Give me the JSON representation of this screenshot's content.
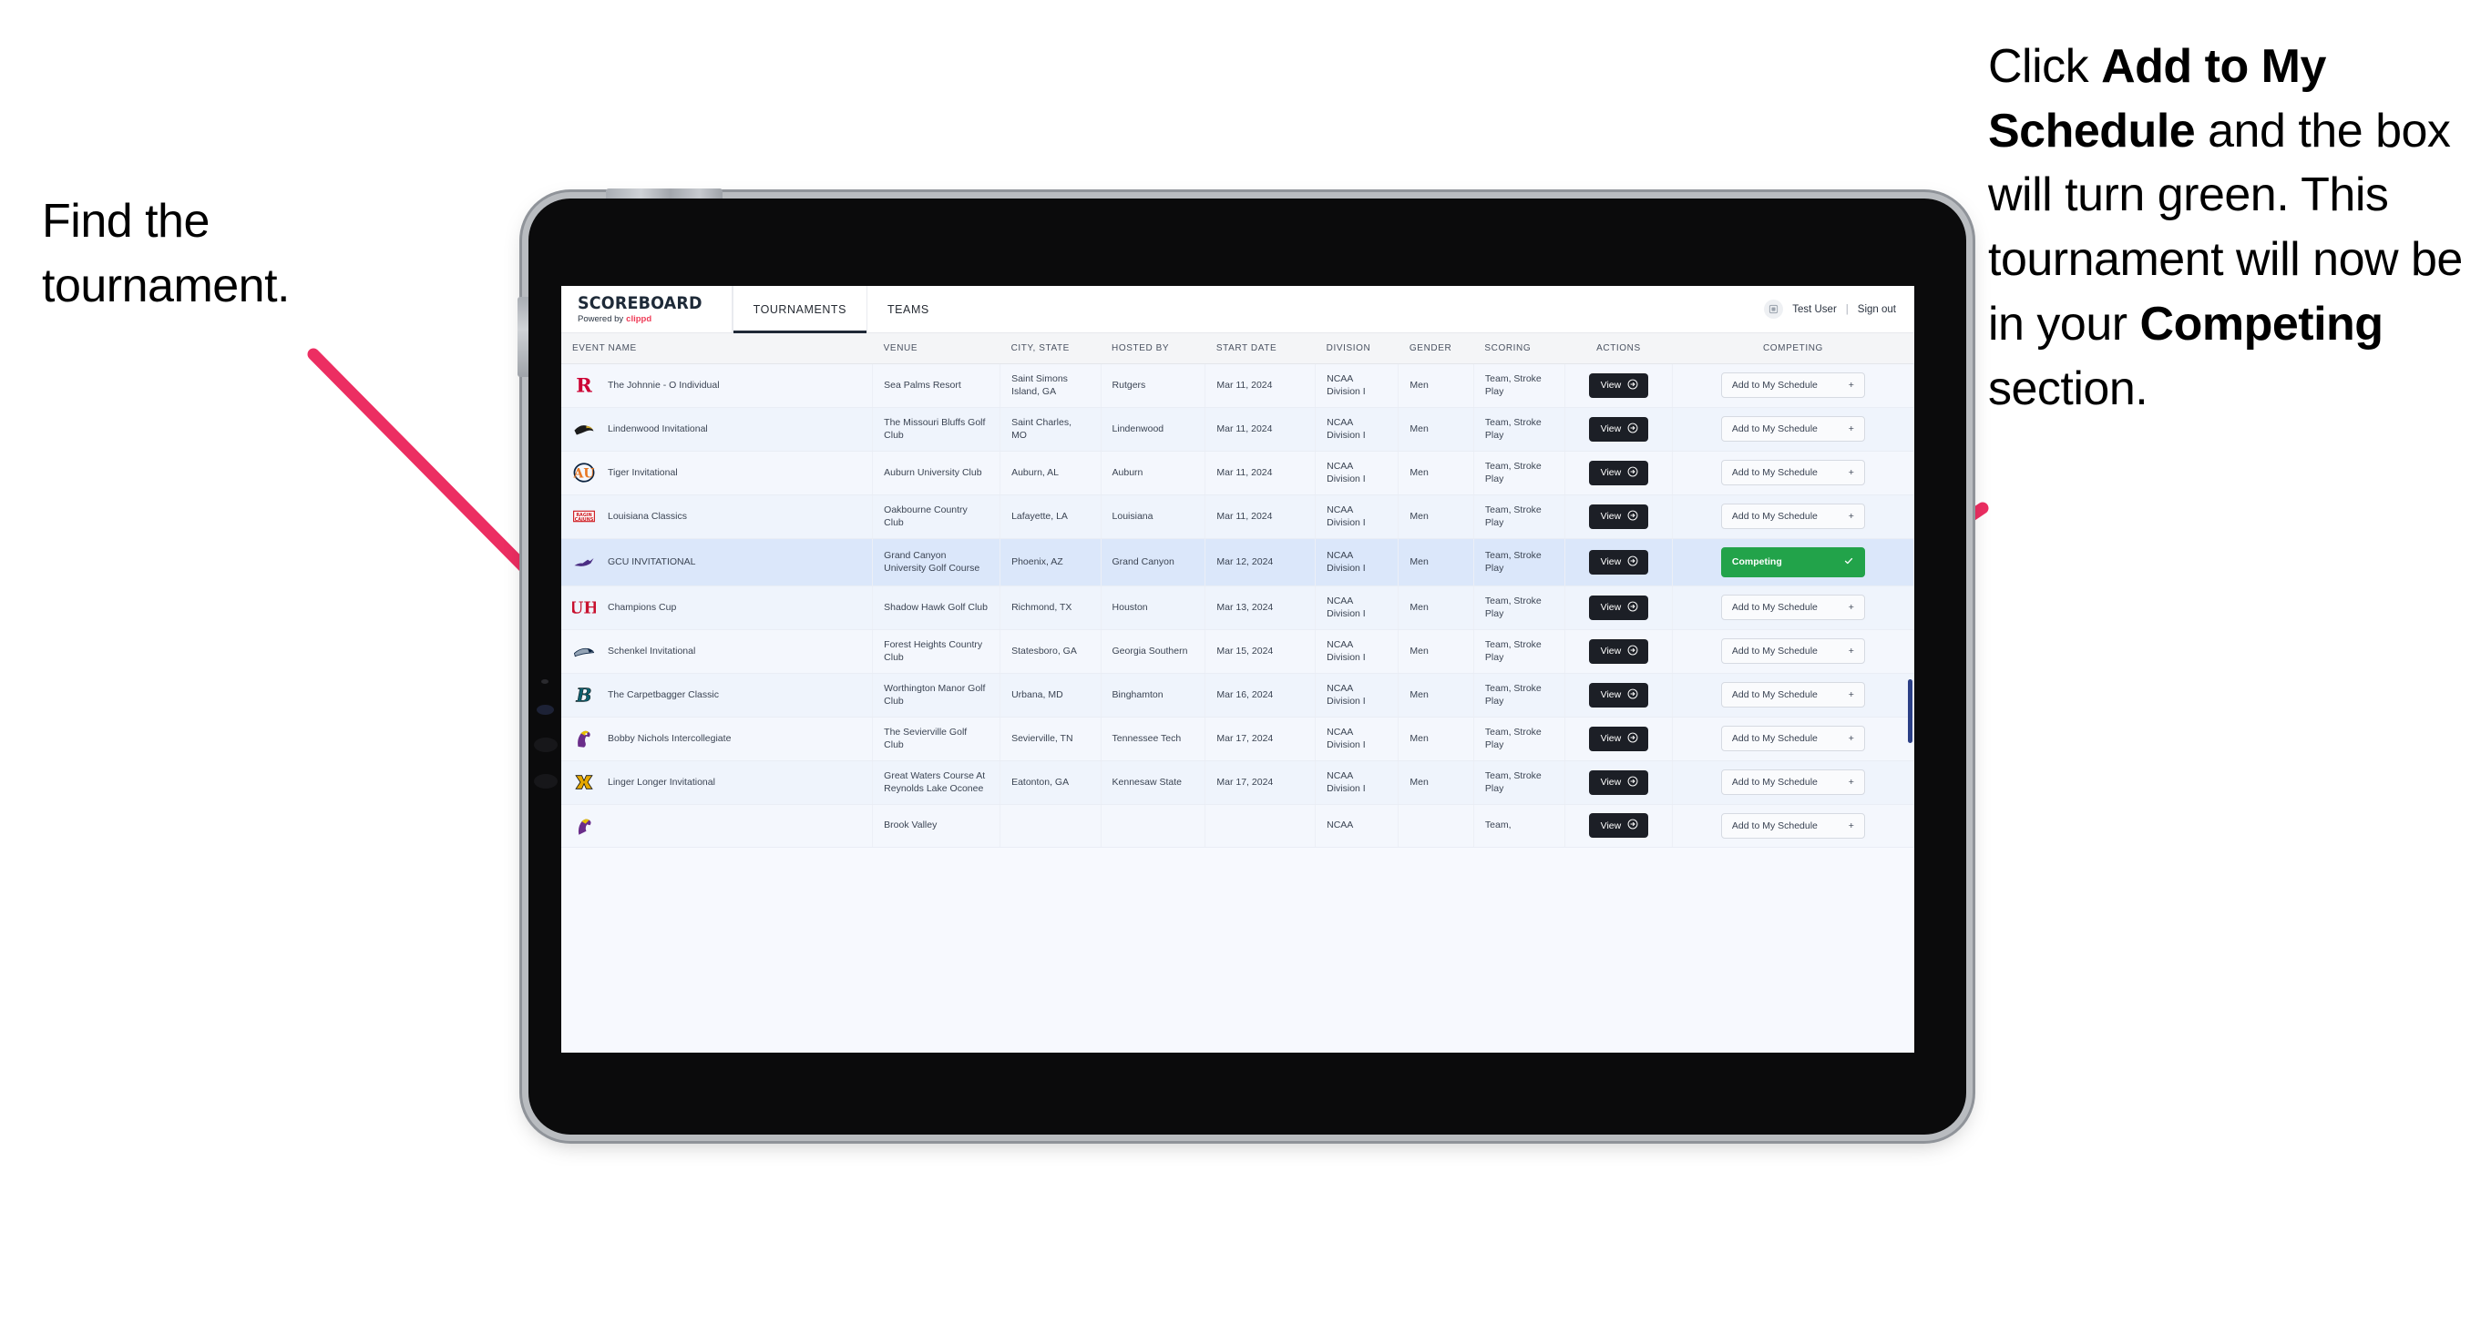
{
  "annotations": {
    "left": {
      "line1": "Find the",
      "line2": "tournament."
    },
    "right": {
      "seg1": "Click ",
      "bold1": "Add to My Schedule",
      "seg2": " and the box will turn green. This tournament will now be in your ",
      "bold2": "Competing",
      "seg3": " section."
    },
    "arrow_color": "#EC2E62"
  },
  "app": {
    "brand": {
      "title": "SCOREBOARD",
      "powered_prefix": "Powered by",
      "powered_brand": "clippd",
      "brand_accent": "#EF3B57"
    },
    "nav": [
      {
        "label": "TOURNAMENTS",
        "active": true
      },
      {
        "label": "TEAMS",
        "active": false
      }
    ],
    "user": {
      "avatar_icon": "user-badge-icon",
      "name": "Test User",
      "separator": "|",
      "signout": "Sign out"
    },
    "table": {
      "columns": [
        "EVENT NAME",
        "VENUE",
        "CITY, STATE",
        "HOSTED BY",
        "START DATE",
        "DIVISION",
        "GENDER",
        "SCORING",
        "ACTIONS",
        "COMPETING"
      ],
      "view_label": "View",
      "add_label": "Add to My Schedule",
      "add_glyph": "+",
      "competing_label": "Competing",
      "competing_color": "#22A34A",
      "rows": [
        {
          "logo": "rutgers-r-logo",
          "event": "The Johnnie - O Individual",
          "venue": "Sea Palms Resort",
          "city": "Saint Simons Island, GA",
          "host": "Rutgers",
          "date": "Mar 11, 2024",
          "division": "NCAA Division I",
          "gender": "Men",
          "scoring": "Team, Stroke Play",
          "competing": false
        },
        {
          "logo": "lindenwood-lion-logo",
          "event": "Lindenwood Invitational",
          "venue": "The Missouri Bluffs Golf Club",
          "city": "Saint Charles, MO",
          "host": "Lindenwood",
          "date": "Mar 11, 2024",
          "division": "NCAA Division I",
          "gender": "Men",
          "scoring": "Team, Stroke Play",
          "competing": false
        },
        {
          "logo": "auburn-au-logo",
          "event": "Tiger Invitational",
          "venue": "Auburn University Club",
          "city": "Auburn, AL",
          "host": "Auburn",
          "date": "Mar 11, 2024",
          "division": "NCAA Division I",
          "gender": "Men",
          "scoring": "Team, Stroke Play",
          "competing": false
        },
        {
          "logo": "ragin-cajuns-logo",
          "event": "Louisiana Classics",
          "venue": "Oakbourne Country Club",
          "city": "Lafayette, LA",
          "host": "Louisiana",
          "date": "Mar 11, 2024",
          "division": "NCAA Division I",
          "gender": "Men",
          "scoring": "Team, Stroke Play",
          "competing": false
        },
        {
          "logo": "gcu-lope-logo",
          "event": "GCU INVITATIONAL",
          "venue": "Grand Canyon University Golf Course",
          "city": "Phoenix, AZ",
          "host": "Grand Canyon",
          "date": "Mar 12, 2024",
          "division": "NCAA Division I",
          "gender": "Men",
          "scoring": "Team, Stroke Play",
          "competing": true
        },
        {
          "logo": "houston-uh-logo",
          "event": "Champions Cup",
          "venue": "Shadow Hawk Golf Club",
          "city": "Richmond, TX",
          "host": "Houston",
          "date": "Mar 13, 2024",
          "division": "NCAA Division I",
          "gender": "Men",
          "scoring": "Team, Stroke Play",
          "competing": false
        },
        {
          "logo": "georgia-southern-eagle-logo",
          "event": "Schenkel Invitational",
          "venue": "Forest Heights Country Club",
          "city": "Statesboro, GA",
          "host": "Georgia Southern",
          "date": "Mar 15, 2024",
          "division": "NCAA Division I",
          "gender": "Men",
          "scoring": "Team, Stroke Play",
          "competing": false
        },
        {
          "logo": "binghamton-b-logo",
          "event": "The Carpetbagger Classic",
          "venue": "Worthington Manor Golf Club",
          "city": "Urbana, MD",
          "host": "Binghamton",
          "date": "Mar 16, 2024",
          "division": "NCAA Division I",
          "gender": "Men",
          "scoring": "Team, Stroke Play",
          "competing": false
        },
        {
          "logo": "tennessee-tech-eagle-logo",
          "event": "Bobby Nichols Intercollegiate",
          "venue": "The Sevierville Golf Club",
          "city": "Sevierville, TN",
          "host": "Tennessee Tech",
          "date": "Mar 17, 2024",
          "division": "NCAA Division I",
          "gender": "Men",
          "scoring": "Team, Stroke Play",
          "competing": false
        },
        {
          "logo": "kennesaw-ks-logo",
          "event": "Linger Longer Invitational",
          "venue": "Great Waters Course At Reynolds Lake Oconee",
          "city": "Eatonton, GA",
          "host": "Kennesaw State",
          "date": "Mar 17, 2024",
          "division": "NCAA Division I",
          "gender": "Men",
          "scoring": "Team, Stroke Play",
          "competing": false
        },
        {
          "logo": "partial-eagle-logo",
          "event": "",
          "venue": "Brook Valley",
          "city": "",
          "host": "",
          "date": "",
          "division": "NCAA",
          "gender": "",
          "scoring": "Team,",
          "competing": false,
          "partial": true
        }
      ]
    }
  }
}
